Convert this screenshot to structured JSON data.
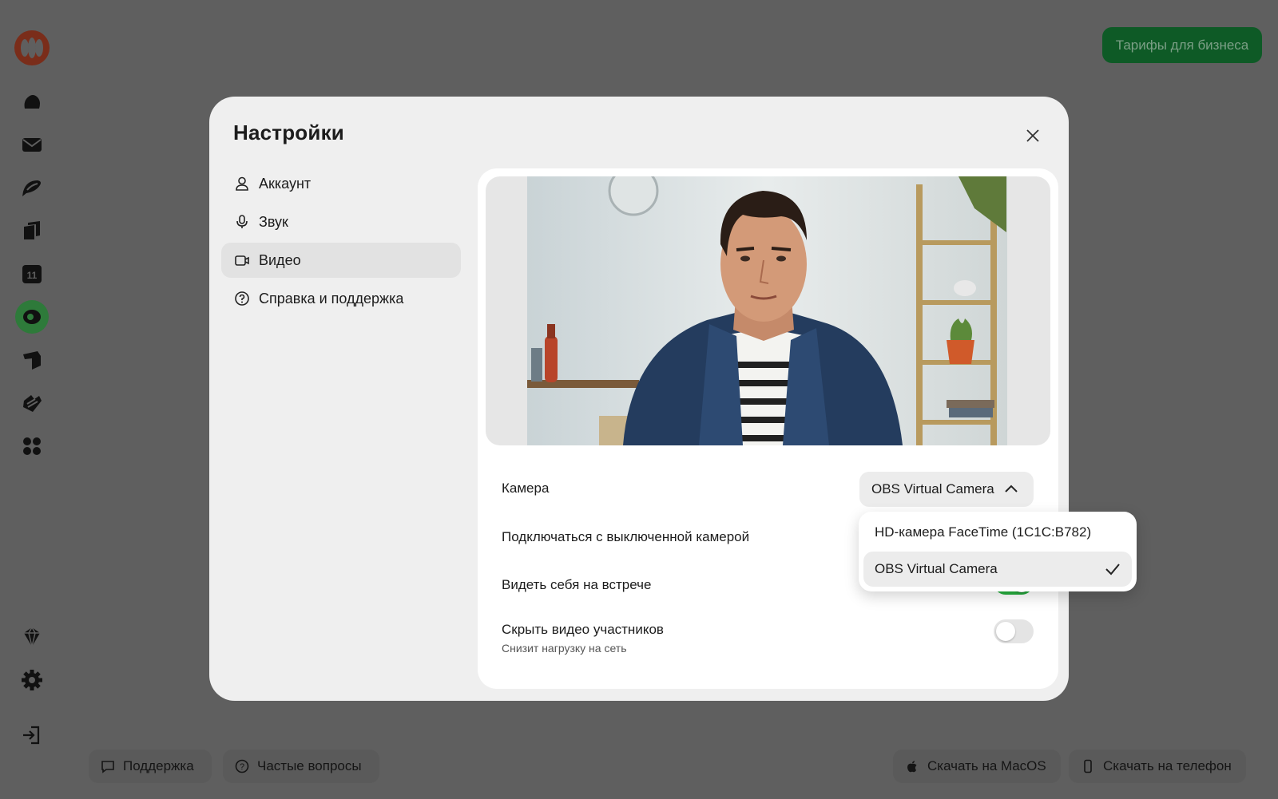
{
  "top_button": {
    "label": "Тарифы для бизнеса"
  },
  "rail": {
    "icons": [
      "telemost-logo",
      "cloud-icon",
      "mail-icon",
      "messenger-icon",
      "documents-icon",
      "calendar-icon",
      "telemost-icon",
      "notes-icon",
      "forms-icon",
      "apps-icon",
      "premium-icon",
      "settings-icon",
      "logout-icon"
    ],
    "calendar_day": "11",
    "active_color": "#2e7a3a"
  },
  "bottom_bar": {
    "support": "Поддержка",
    "faq": "Частые вопросы",
    "download_mac": "Скачать на MacOS",
    "download_phone": "Скачать на телефон"
  },
  "settings": {
    "title": "Настройки",
    "nav": [
      {
        "label": "Аккаунт",
        "icon": "user-icon"
      },
      {
        "label": "Звук",
        "icon": "microphone-icon"
      },
      {
        "label": "Видео",
        "icon": "video-camera-icon",
        "active": true
      },
      {
        "label": "Справка и поддержка",
        "icon": "help-icon"
      }
    ],
    "video": {
      "camera_label": "Камера",
      "camera_value": "OBS Virtual Camera",
      "join_camera_off_label": "Подключаться с выключенной камерой",
      "self_view_label": "Видеть себя на встрече",
      "self_view_on": true,
      "hide_video_label": "Скрыть видео участников",
      "hide_video_sub": "Снизит нагрузку на сеть",
      "hide_video_on": false
    },
    "camera_dropdown": {
      "options": [
        "HD-камера FaceTime (1C1C:B782)",
        "OBS Virtual Camera"
      ],
      "selected": "OBS Virtual Camera"
    }
  },
  "colors": {
    "accent_green": "#27b03f",
    "overlay": "#5f5f5f",
    "business_button": "#0e5a26"
  }
}
